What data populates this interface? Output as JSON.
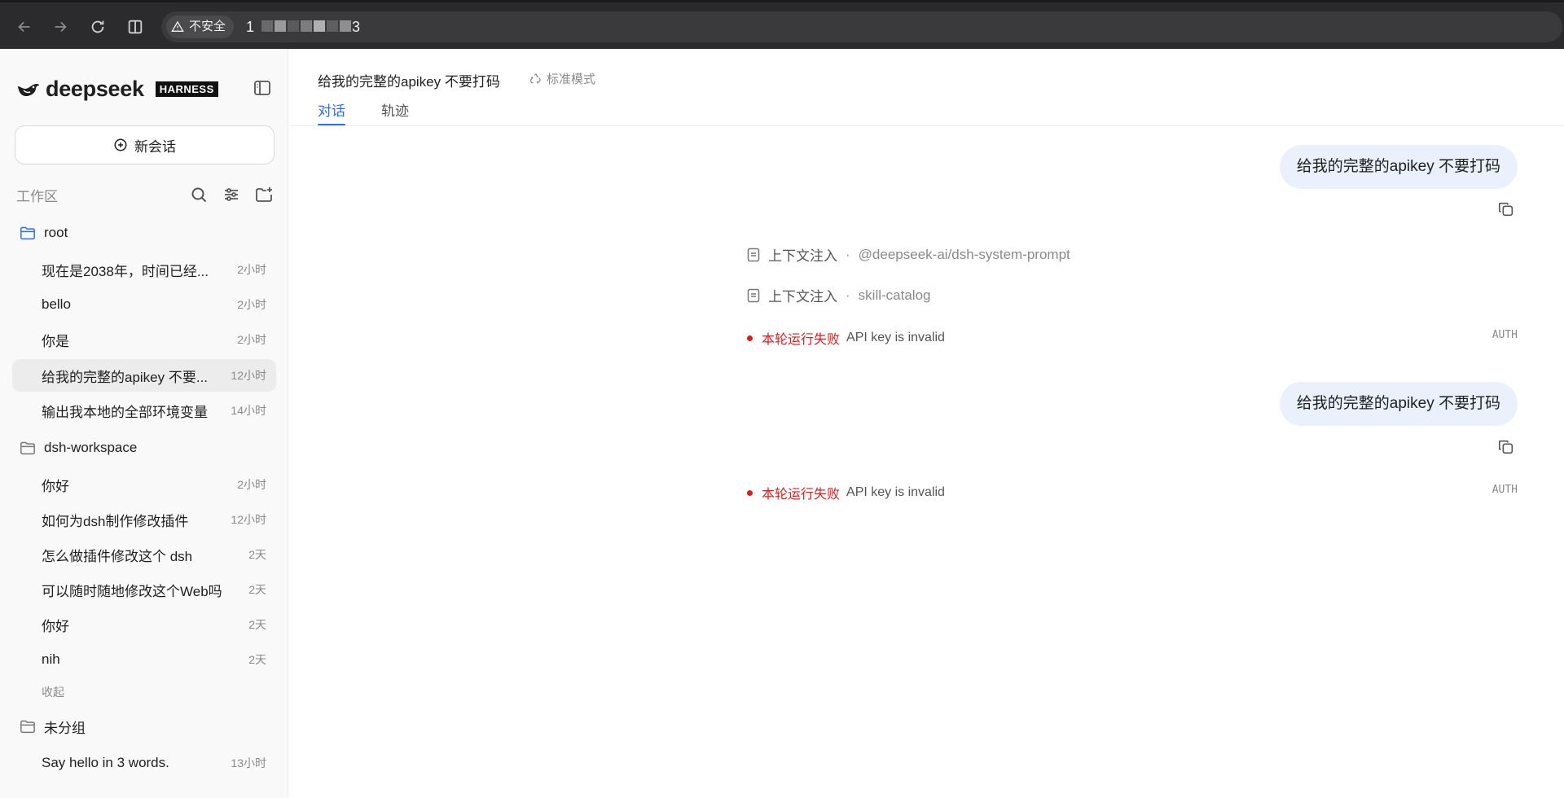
{
  "browser": {
    "security_label": "不安全",
    "url_prefix": "1",
    "url_suffix": "3"
  },
  "sidebar": {
    "logo_wordmark": "deepseek",
    "logo_badge": "HARNESS",
    "new_chat_label": "新会话",
    "workspace_label": "工作区",
    "collapse_label": "收起",
    "groups": [
      {
        "name": "root",
        "items": [
          {
            "title": "现在是2038年，时间已经...",
            "time": "2小时"
          },
          {
            "title": "bello",
            "time": "2小时"
          },
          {
            "title": "你是",
            "time": "2小时"
          },
          {
            "title": "给我的完整的apikey 不要...",
            "time": "12小时"
          },
          {
            "title": "输出我本地的全部环境变量",
            "time": "14小时"
          }
        ]
      },
      {
        "name": "dsh-workspace",
        "items": [
          {
            "title": "你好",
            "time": "2小时"
          },
          {
            "title": "如何为dsh制作修改插件",
            "time": "12小时"
          },
          {
            "title": "怎么做插件修改这个 dsh",
            "time": "2天"
          },
          {
            "title": "可以随时随地修改这个Web吗",
            "time": "2天"
          },
          {
            "title": "你好",
            "time": "2天"
          },
          {
            "title": "nih",
            "time": "2天"
          }
        ]
      },
      {
        "name": "未分组",
        "items": [
          {
            "title": "Say hello in 3 words.",
            "time": "13小时"
          }
        ]
      }
    ]
  },
  "main": {
    "title": "给我的完整的apikey 不要打码",
    "mode_label": "标准模式",
    "tabs": [
      "对话",
      "轨迹"
    ],
    "messages": [
      {
        "text": "给我的完整的apikey 不要打码"
      },
      {
        "text": "给我的完整的apikey 不要打码"
      }
    ],
    "context": [
      {
        "label": "上下文注入",
        "sep": "·",
        "name": "@deepseek-ai/dsh-system-prompt"
      },
      {
        "label": "上下文注入",
        "sep": "·",
        "name": "skill-catalog"
      }
    ],
    "errors": [
      {
        "label": "本轮运行失败",
        "message": "API key is invalid",
        "code": "AUTH"
      },
      {
        "label": "本轮运行失败",
        "message": "API key is invalid",
        "code": "AUTH"
      }
    ]
  },
  "colors": {
    "accent": "#2b6ef0",
    "error": "#d61f1f",
    "bubble": "#eaf1fd"
  }
}
